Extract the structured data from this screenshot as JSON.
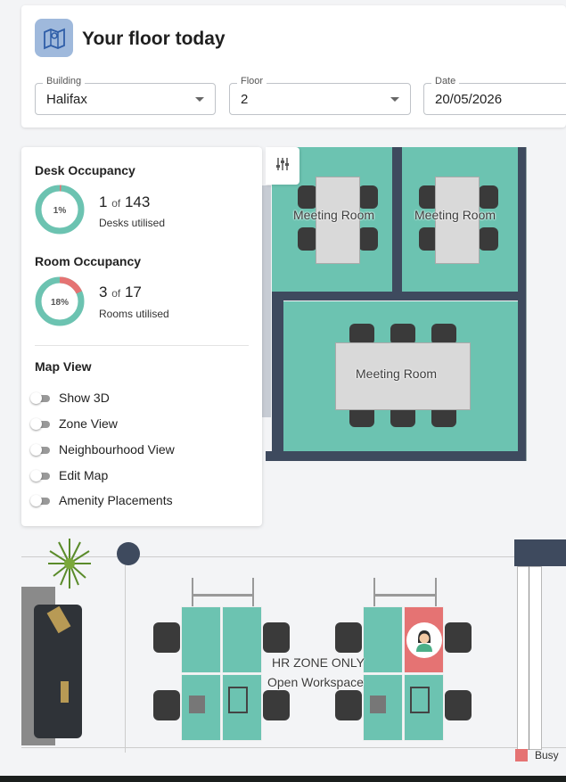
{
  "header": {
    "title": "Your floor today",
    "icon": "map-location-icon"
  },
  "filters": {
    "building": {
      "label": "Building",
      "value": "Halifax"
    },
    "floor": {
      "label": "Floor",
      "value": "2"
    },
    "date": {
      "label": "Date",
      "value": "20/05/2026"
    }
  },
  "panel": {
    "desk": {
      "title": "Desk Occupancy",
      "percent_label": "1%",
      "percent": 1,
      "used": "1",
      "of": "of",
      "total": "143",
      "caption": "Desks utilised"
    },
    "room": {
      "title": "Room Occupancy",
      "percent_label": "18%",
      "percent": 18,
      "used": "3",
      "of": "of",
      "total": "17",
      "caption": "Rooms utilised"
    },
    "map_view": {
      "title": "Map View",
      "toggles": [
        {
          "label": "Show 3D",
          "on": false
        },
        {
          "label": "Zone View",
          "on": false
        },
        {
          "label": "Neighbourhood View",
          "on": false
        },
        {
          "label": "Edit Map",
          "on": false
        },
        {
          "label": "Amenity Placements",
          "on": false
        }
      ]
    }
  },
  "map": {
    "rooms": [
      "Meeting Room",
      "Meeting Room",
      "Meeting Room"
    ],
    "zone_label_1": "HR ZONE ONLY",
    "zone_label_2": "Open Workspace"
  },
  "legend": {
    "busy_label": "Busy"
  },
  "colors": {
    "available": "#6cc3b1",
    "busy": "#e57373",
    "wall": "#3e4a5e",
    "donut_track": "#6cc3b1",
    "donut_fill": "#e57373"
  }
}
